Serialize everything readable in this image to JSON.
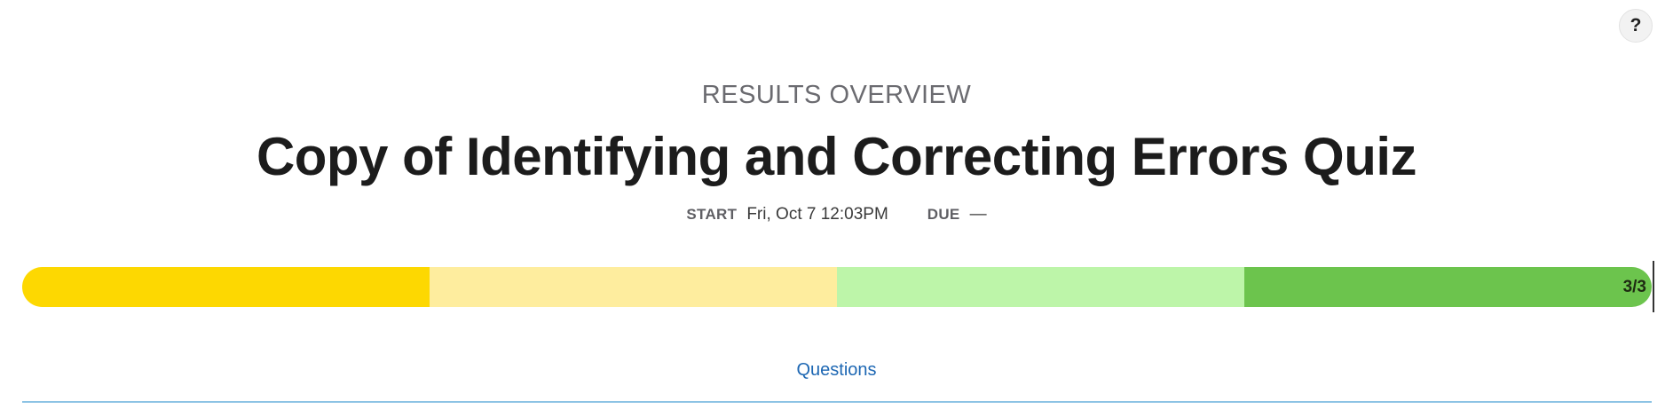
{
  "header": {
    "help_label": "?",
    "overline": "RESULTS OVERVIEW",
    "title": "Copy of Identifying and Correcting Errors Quiz"
  },
  "meta": {
    "start_label": "START",
    "start_value": "Fri, Oct 7 12:03PM",
    "due_label": "DUE",
    "due_value": "—"
  },
  "progress": {
    "label": "3/3",
    "segments": [
      {
        "color": "#fdd801"
      },
      {
        "color": "#feed9e"
      },
      {
        "color": "#bdf5a9"
      },
      {
        "color": "#6cc44d"
      }
    ]
  },
  "tabs": {
    "questions_label": "Questions"
  }
}
